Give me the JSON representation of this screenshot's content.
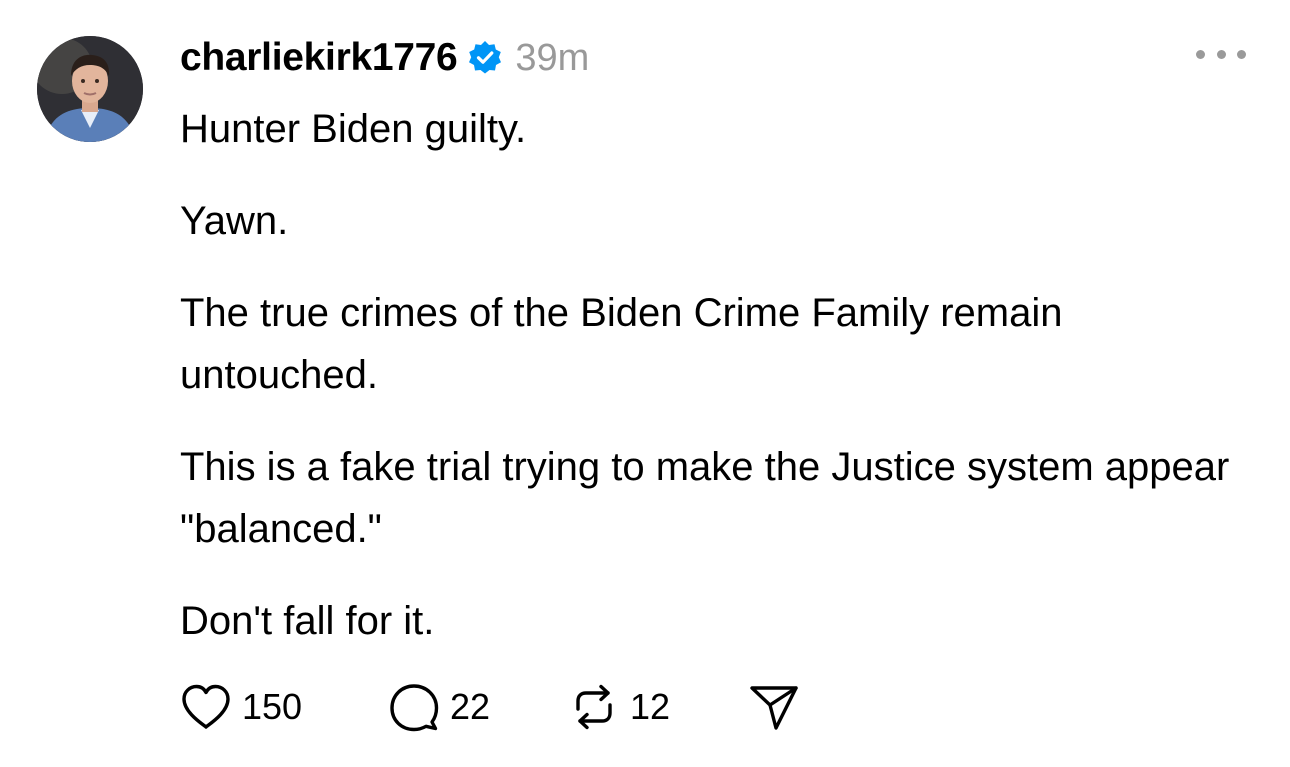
{
  "post": {
    "username": "charliekirk1776",
    "verified": true,
    "timestamp": "39m",
    "paragraphs": [
      "Hunter Biden guilty.",
      "Yawn.",
      "The true crimes of the Biden Crime Family remain untouched.",
      "This is a fake trial trying to make the Justice system appear \"balanced.\"",
      "Don't fall for it."
    ],
    "actions": {
      "likes": "150",
      "replies": "22",
      "reposts": "12"
    }
  },
  "icons": {
    "verified": "verified-badge-icon",
    "more": "more-options-icon",
    "like": "heart-icon",
    "reply": "comment-bubble-icon",
    "repost": "repost-icon",
    "share": "send-icon"
  },
  "colors": {
    "verified_badge": "#0095f6",
    "timestamp": "#999999",
    "text": "#000000"
  }
}
